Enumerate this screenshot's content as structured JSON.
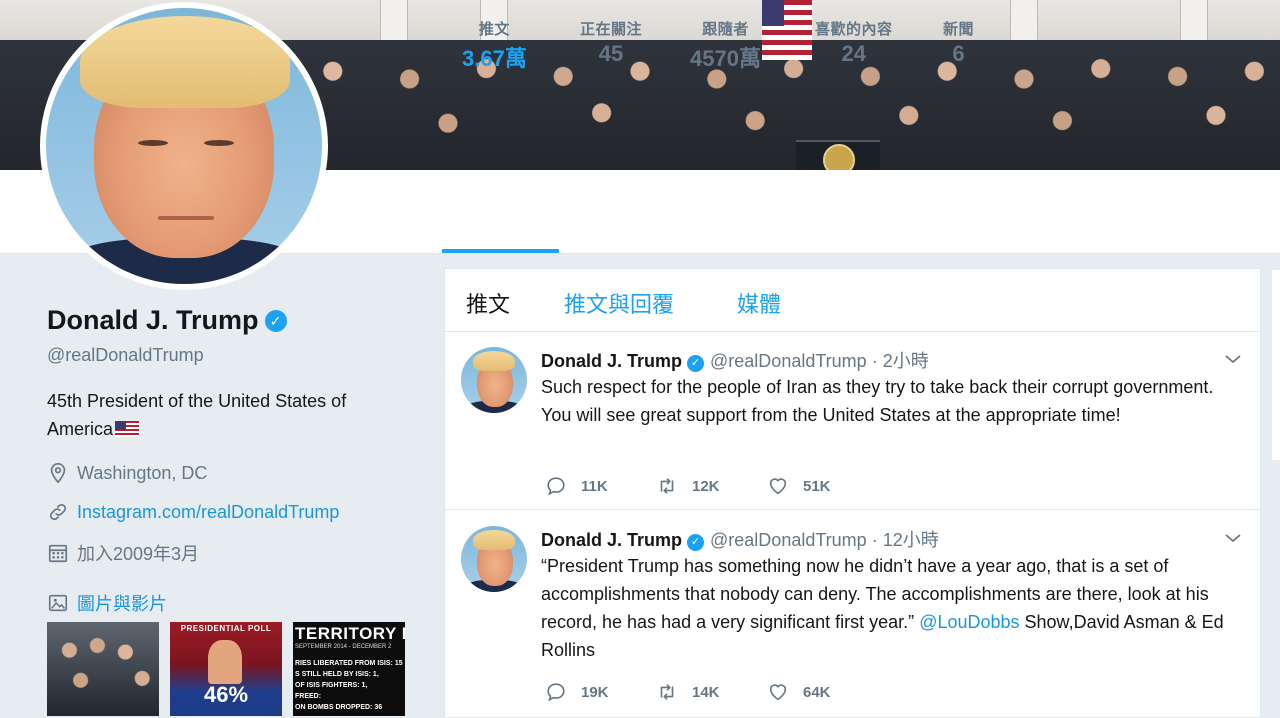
{
  "stats": [
    {
      "label": "推文",
      "value": "3.67萬",
      "active": true
    },
    {
      "label": "正在關注",
      "value": "45",
      "active": false
    },
    {
      "label": "跟隨者",
      "value": "4570萬",
      "active": false
    },
    {
      "label": "喜歡的內容",
      "value": "24",
      "active": false
    },
    {
      "label": "新聞",
      "value": "6",
      "active": false
    }
  ],
  "profile": {
    "name": "Donald J. Trump",
    "handle": "@realDonaldTrump",
    "bio": "45th President of the United States of America",
    "location": "Washington, DC",
    "website": "Instagram.com/realDonaldTrump",
    "joined": "加入2009年3月",
    "photos_label": "圖片與影片"
  },
  "thumbs": {
    "poll_top": "PRESIDENTIAL POLL",
    "poll_pct": "46%",
    "territory_title": "TERRITORY I",
    "territory_sub": "SEPTEMBER 2014 - DECEMBER 2",
    "territory_rows": [
      "RIES LIBERATED FROM ISIS: 15",
      "S STILL HELD BY ISIS: 1,",
      "OF ISIS FIGHTERS: 1,",
      "FREED: ",
      "ON BOMBS DROPPED: 36"
    ]
  },
  "tabs": [
    "推文",
    "推文與回覆",
    "媒體"
  ],
  "tweets": [
    {
      "name": "Donald J. Trump",
      "handle": "@realDonaldTrump",
      "time": "· 2小時",
      "text": "Such respect for the people of Iran as they try to take back their corrupt government. You will see great support from the United States at the appropriate time!",
      "mention": "",
      "text_after": "",
      "replies": "11K",
      "retweets": "12K",
      "likes": "51K"
    },
    {
      "name": "Donald J. Trump",
      "handle": "@realDonaldTrump",
      "time": "· 12小時",
      "text": "“President Trump has something now he didn’t have a year ago, that is a set of accomplishments that nobody can deny. The accomplishments are there, look at his record, he has had a very significant first year.” ",
      "mention": "@LouDobbs",
      "text_after": " Show,David Asman & Ed Rollins",
      "replies": "19K",
      "retweets": "14K",
      "likes": "64K"
    }
  ],
  "colors": {
    "accent": "#1da1f2",
    "link": "#1b95e0",
    "muted": "#657786",
    "bg": "#e6ecf0"
  }
}
